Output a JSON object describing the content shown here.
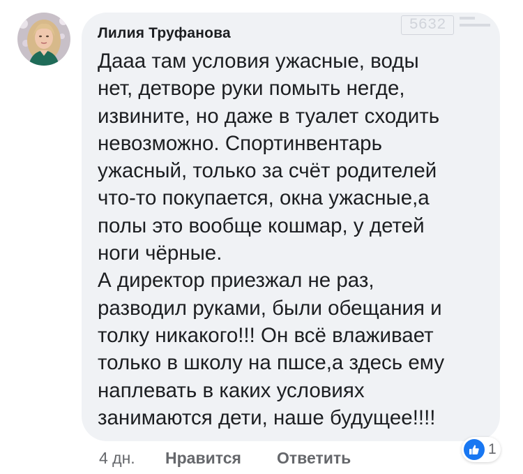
{
  "comment": {
    "author": "Лилия Труфанова",
    "lines": [
      "Дааа там условия ужасные, воды",
      "нет, детворе руки помыть негде,",
      "извините, но даже в туалет сходить",
      "невозможно. Спортинвентарь",
      "ужасный, только за счёт родителей",
      "что-то покупается, окна ужасные,а",
      "полы это вообще кошмар, у детей",
      "ноги чёрные.",
      "А директор приезжал не раз,",
      "разводил руками, были обещания и",
      "толку никакого!!! Он всё влаживает",
      "только в школу на пшсе,а здесь ему",
      "наплевать в каких условиях",
      "занимаются дети, наше будущее!!!!"
    ]
  },
  "actions": {
    "time": "4 дн.",
    "like_label": "Нравится",
    "reply_label": "Ответить"
  },
  "reactions": {
    "icon": "like-thumb-icon",
    "count": "1",
    "color": "#1877f2"
  },
  "watermark": {
    "number": "5632",
    "logo": "watermark-logo"
  },
  "colors": {
    "bubble": "#f0f2f5",
    "text": "#1c1e21",
    "secondary": "#65676b"
  }
}
